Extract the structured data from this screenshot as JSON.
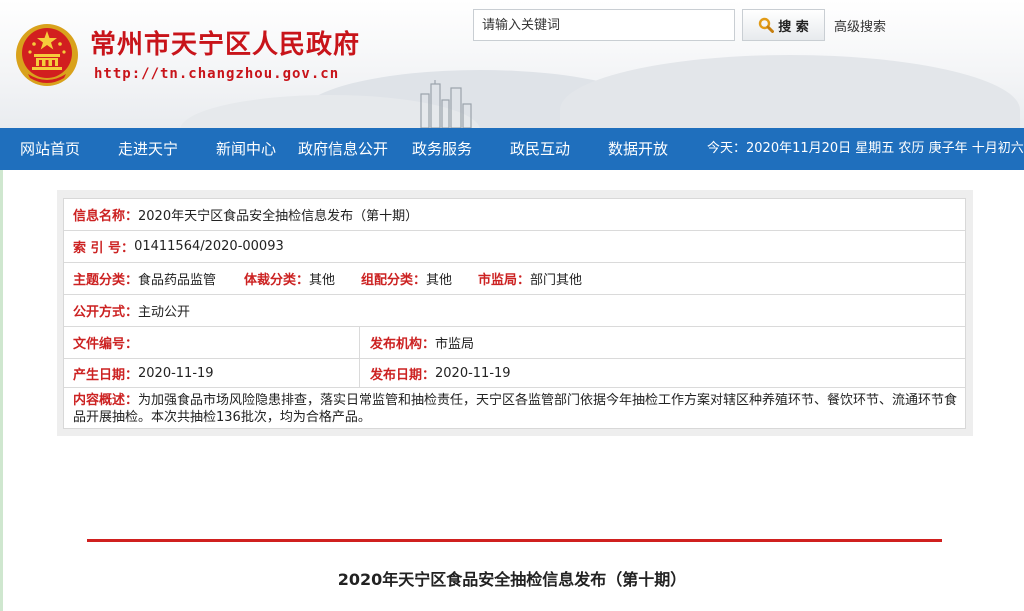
{
  "header": {
    "site_title": "常州市天宁区人民政府",
    "site_url": "http://tn.changzhou.gov.cn",
    "search_placeholder": "请输入关键词",
    "search_button_label": "搜 索",
    "advanced_search_label": "高级搜索"
  },
  "nav": {
    "items": [
      "网站首页",
      "走进天宁",
      "新闻中心",
      "政府信息公开",
      "政务服务",
      "政民互动",
      "数据开放"
    ],
    "today": "今天：2020年11月20日 星期五 农历 庚子年 十月初六"
  },
  "info": {
    "name_label": "信息名称：",
    "name_value": "2020年天宁区食品安全抽检信息发布（第十期）",
    "index_label": "索 引 号：",
    "index_value": "01411564/2020-00093",
    "topic_label": "主题分类：",
    "topic_value": "食品药品监管",
    "genre_label": "体裁分类：",
    "genre_value": "其他",
    "org_class_label": "组配分类：",
    "org_class_value": "其他",
    "bureau_label": "市监局：",
    "bureau_value": "部门其他",
    "open_mode_label": "公开方式：",
    "open_mode_value": "主动公开",
    "doc_no_label": "文件编号：",
    "doc_no_value": "",
    "issuer_label": "发布机构：",
    "issuer_value": "市监局",
    "created_label": "产生日期：",
    "created_value": "2020-11-19",
    "published_label": "发布日期：",
    "published_value": "2020-11-19",
    "summary_label": "内容概述：",
    "summary_value": "为加强食品市场风险隐患排查，落实日常监管和抽检责任，天宁区各监管部门依据今年抽检工作方案对辖区种养殖环节、餐饮环节、流通环节食品开展抽检。本次共抽检136批次，均为合格产品。"
  },
  "article": {
    "title": "2020年天宁区食品安全抽检信息发布（第十期）"
  },
  "colors": {
    "brand_red": "#c8141a",
    "nav_blue": "#1f6fbd",
    "label_red": "#cc2222"
  },
  "icons": [
    "national-emblem-icon",
    "search-icon"
  ]
}
